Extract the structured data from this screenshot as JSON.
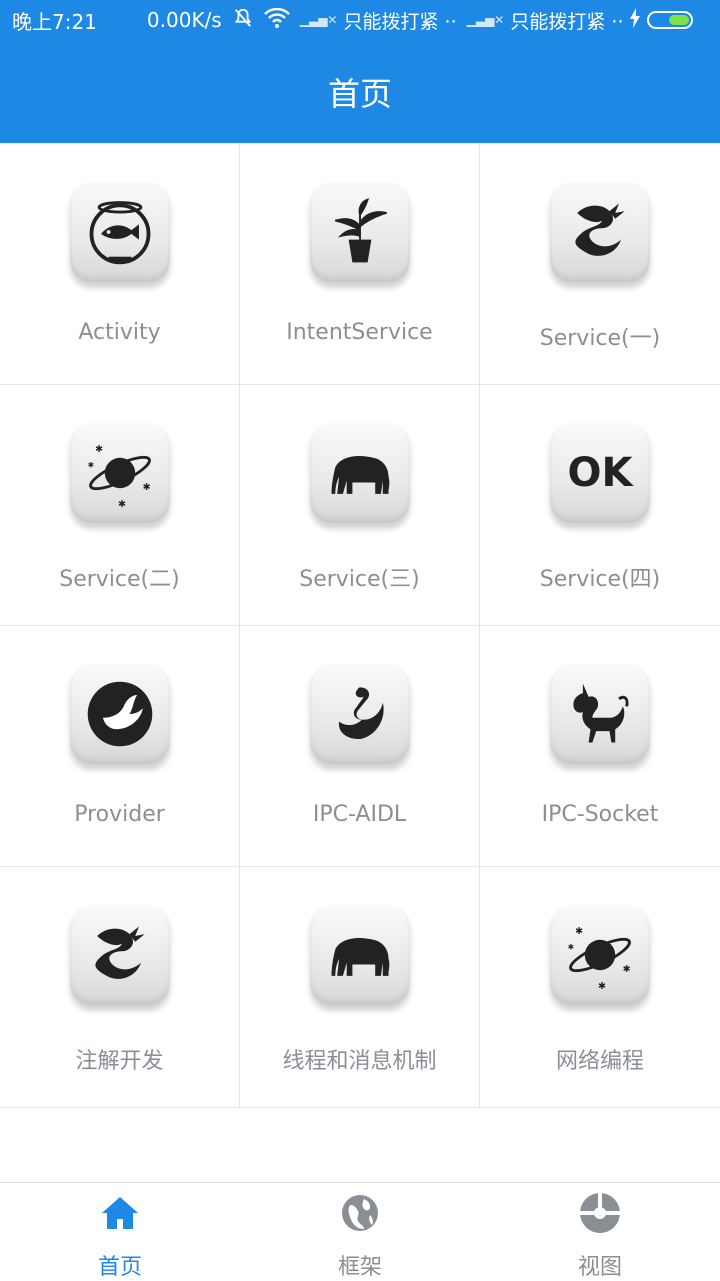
{
  "status_bar": {
    "time": "晚上7:21",
    "speed": "0.00K/s",
    "carrier_1": "只能拨打紧 ··",
    "carrier_2": "只能拨打紧 ··",
    "icons": [
      "mute-bell-icon",
      "wifi-icon",
      "no-signal-icon",
      "charging-icon",
      "battery-icon"
    ]
  },
  "app_bar": {
    "title": "首页"
  },
  "grid": {
    "items": [
      {
        "label": "Activity",
        "icon": "fishbowl-icon"
      },
      {
        "label": "IntentService",
        "icon": "plant-icon"
      },
      {
        "label": "Service(一)",
        "icon": "dragon-icon"
      },
      {
        "label": "Service(二)",
        "icon": "planet-icon"
      },
      {
        "label": "Service(三)",
        "icon": "elephant-icon"
      },
      {
        "label": "Service(四)",
        "icon": "ok-icon",
        "icon_text": "OK"
      },
      {
        "label": "Provider",
        "icon": "dove-icon"
      },
      {
        "label": "IPC-AIDL",
        "icon": "swan-dragon-icon"
      },
      {
        "label": "IPC-Socket",
        "icon": "unicorn-icon"
      },
      {
        "label": "注解开发",
        "icon": "dragon-icon"
      },
      {
        "label": "线程和消息机制",
        "icon": "elephant-icon"
      },
      {
        "label": "网络编程",
        "icon": "planet-icon"
      }
    ]
  },
  "bottom_nav": {
    "items": [
      {
        "label": "首页",
        "icon": "home-icon",
        "active": true
      },
      {
        "label": "框架",
        "icon": "globe-icon",
        "active": false
      },
      {
        "label": "视图",
        "icon": "pie-icon",
        "active": false
      }
    ]
  },
  "colors": {
    "primary": "#1e88e5",
    "label_gray": "#8a8f96",
    "divider": "#e6e6e6"
  }
}
